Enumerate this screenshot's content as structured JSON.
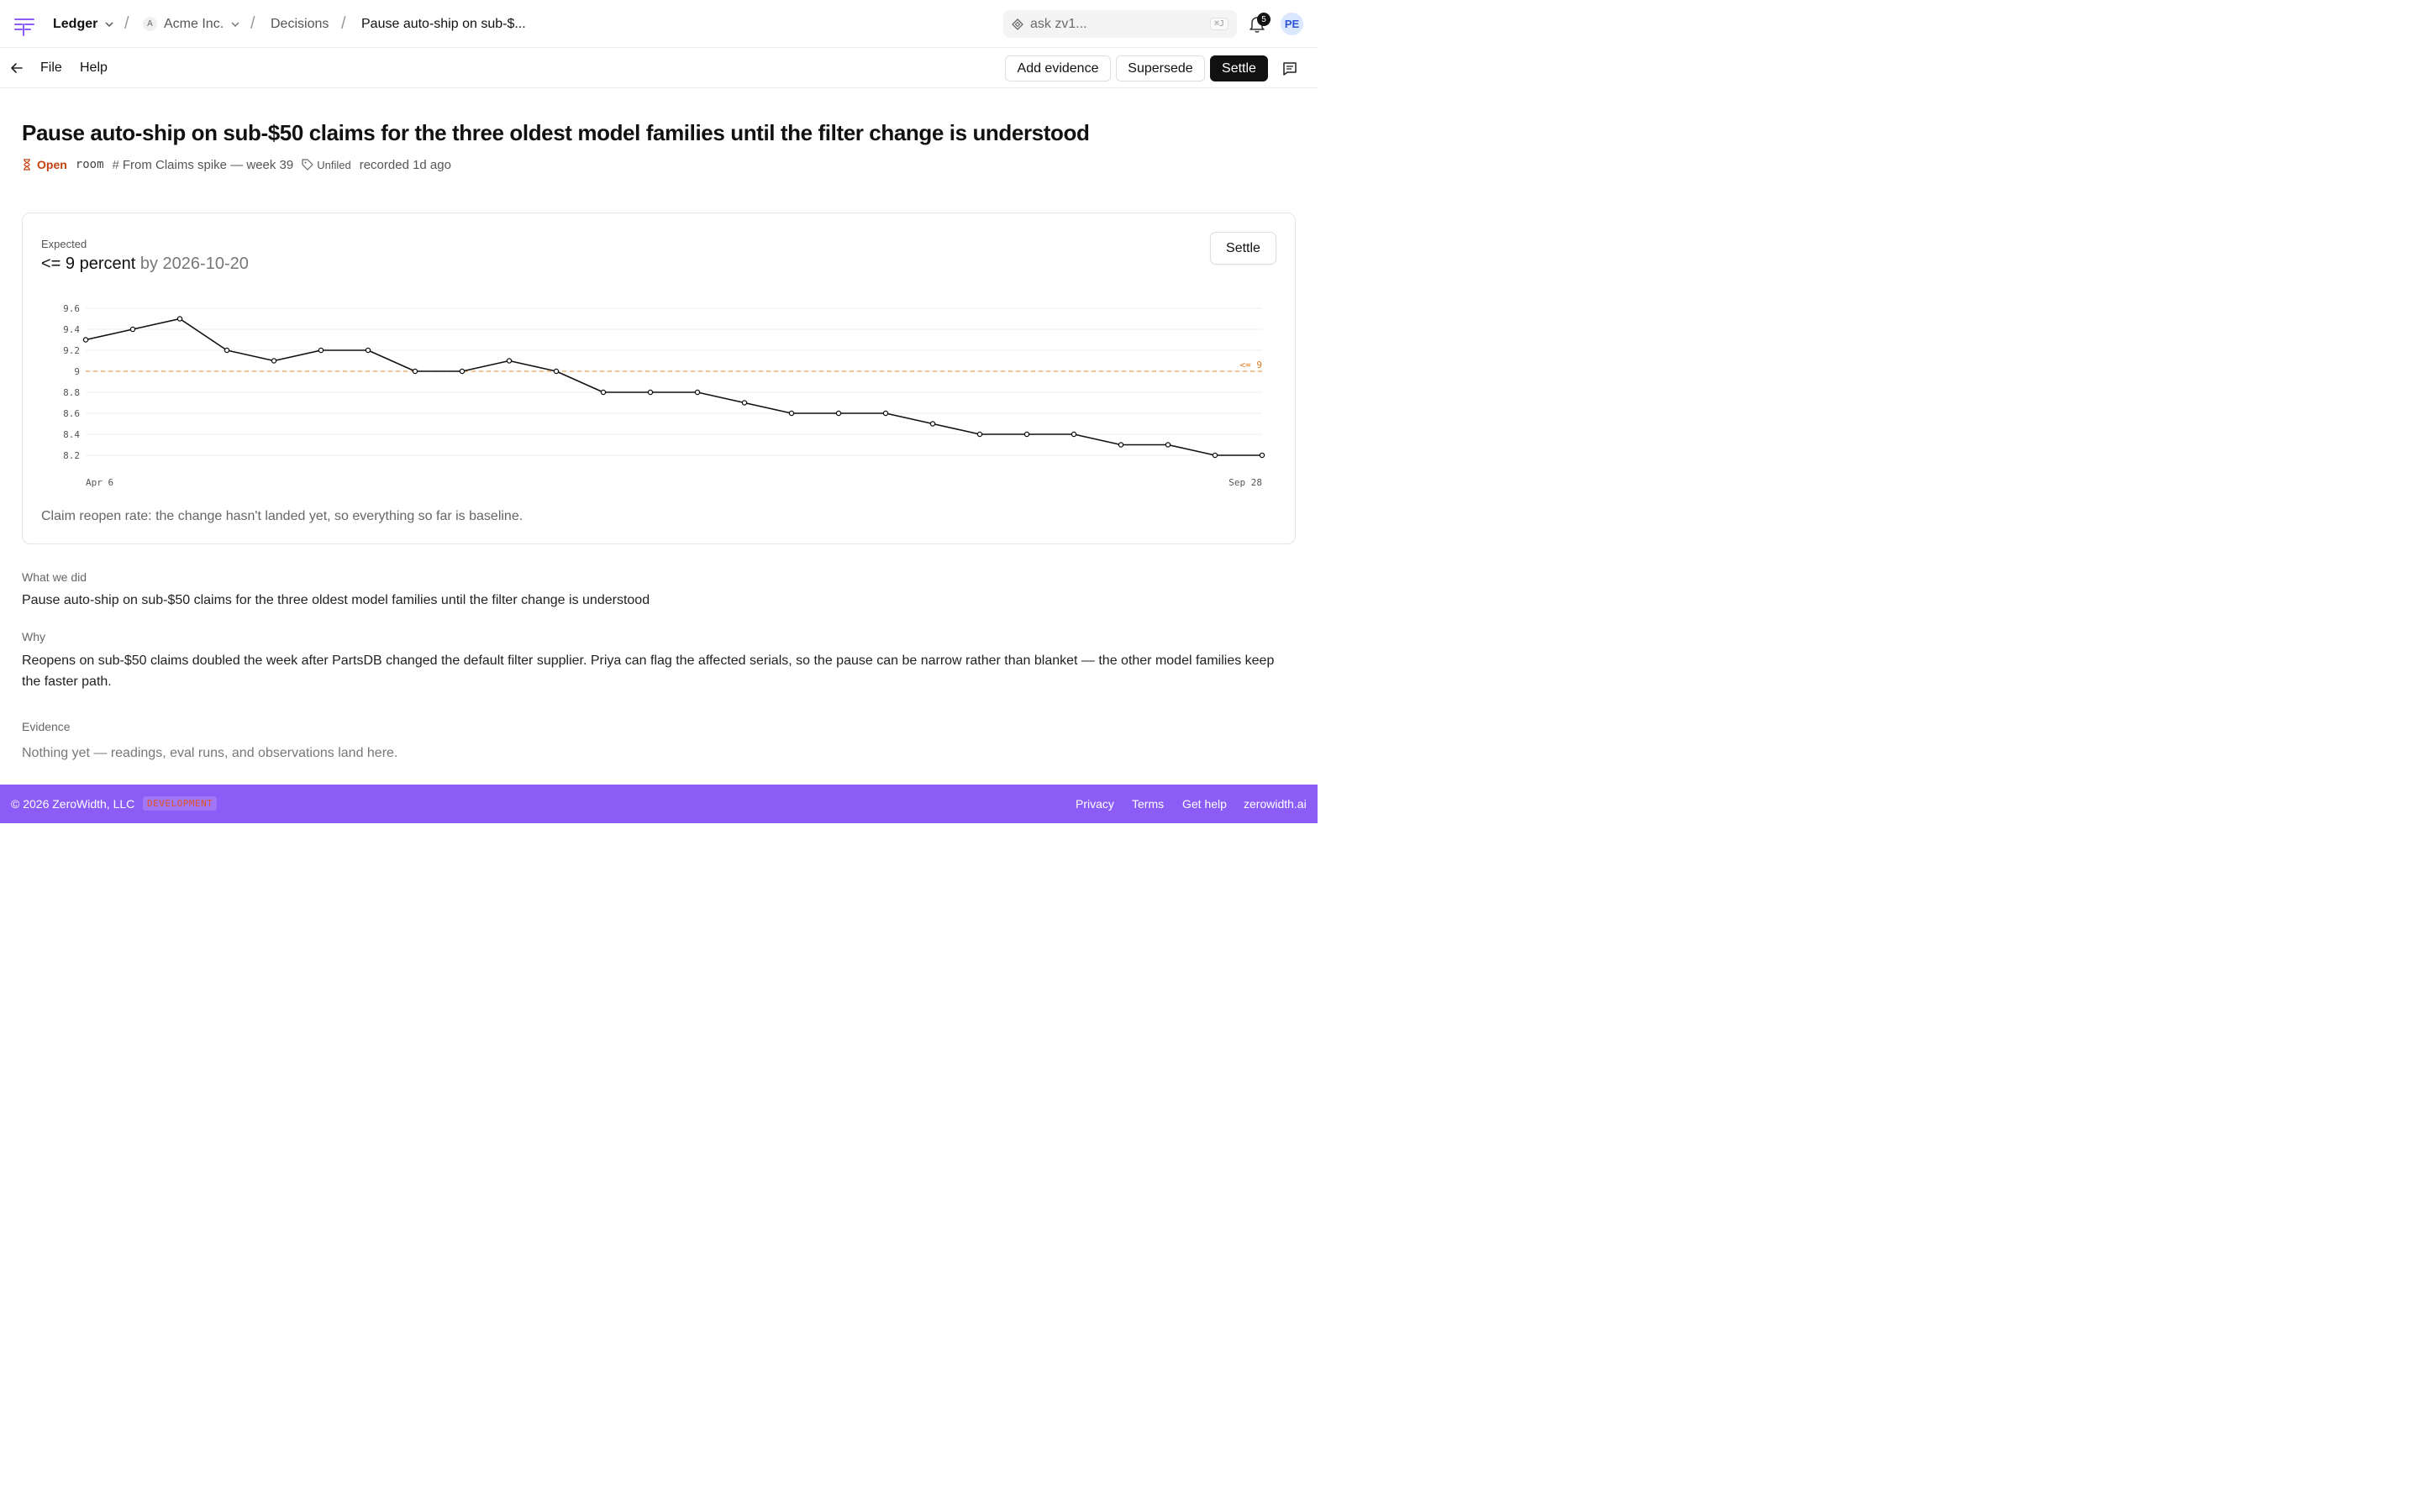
{
  "header": {
    "workspace": "Ledger",
    "org_initial": "A",
    "org": "Acme Inc.",
    "section": "Decisions",
    "current": "Pause auto-ship on sub-$...",
    "search_placeholder": "ask zv1...",
    "search_shortcut": "⌘J",
    "notifications_count": "5",
    "user_initials": "PE"
  },
  "toolbar": {
    "file": "File",
    "help": "Help",
    "add_evidence": "Add evidence",
    "supersede": "Supersede",
    "settle": "Settle"
  },
  "decision": {
    "title": "Pause auto-ship on sub-$50 claims for the three oldest model families until the filter change is understood",
    "status": "Open",
    "visibility": "room",
    "source": "From Claims spike — week 39",
    "tag": "Unfiled",
    "recorded": "recorded 1d ago"
  },
  "expectation": {
    "label": "Expected",
    "value": "<= 9 percent",
    "by": "by 2026-10-20",
    "settle": "Settle",
    "caption": "Claim reopen rate: the change hasn't landed yet, so everything so far is baseline."
  },
  "chart_data": {
    "type": "line",
    "x_start_label": "Apr 6",
    "x_end_label": "Sep 28",
    "values": [
      9.3,
      9.4,
      9.5,
      9.2,
      9.1,
      9.2,
      9.2,
      9.0,
      9.0,
      9.1,
      9.0,
      8.8,
      8.8,
      8.8,
      8.7,
      8.6,
      8.6,
      8.6,
      8.5,
      8.4,
      8.4,
      8.4,
      8.3,
      8.3,
      8.2,
      8.2
    ],
    "y_ticks": [
      "9.6",
      "9.4",
      "9.2",
      "9",
      "8.8",
      "8.6",
      "8.4",
      "8.2"
    ],
    "ylim": [
      8.2,
      9.6
    ],
    "threshold": 9,
    "threshold_label": "<= 9",
    "line_color": "#111111",
    "threshold_color": "#f0a050"
  },
  "sections": {
    "what_label": "What we did",
    "what_text": "Pause auto-ship on sub-$50 claims for the three oldest model families until the filter change is understood",
    "why_label": "Why",
    "why_text": "Reopens on sub-$50 claims doubled the week after PartsDB changed the default filter supplier. Priya can flag the affected serials, so the pause can be narrow rather than blanket — the other model families keep the faster path.",
    "evidence_label": "Evidence",
    "evidence_text": "Nothing yet — readings, eval runs, and observations land here."
  },
  "footer": {
    "copyright": "© 2026 ZeroWidth, LLC",
    "env": "DEVELOPMENT",
    "privacy": "Privacy",
    "terms": "Terms",
    "help": "Get help",
    "site": "zerowidth.ai"
  },
  "colors": {
    "accent": "#8b5cf6",
    "open_status": "#c2410c",
    "primary_button": "#111111"
  }
}
